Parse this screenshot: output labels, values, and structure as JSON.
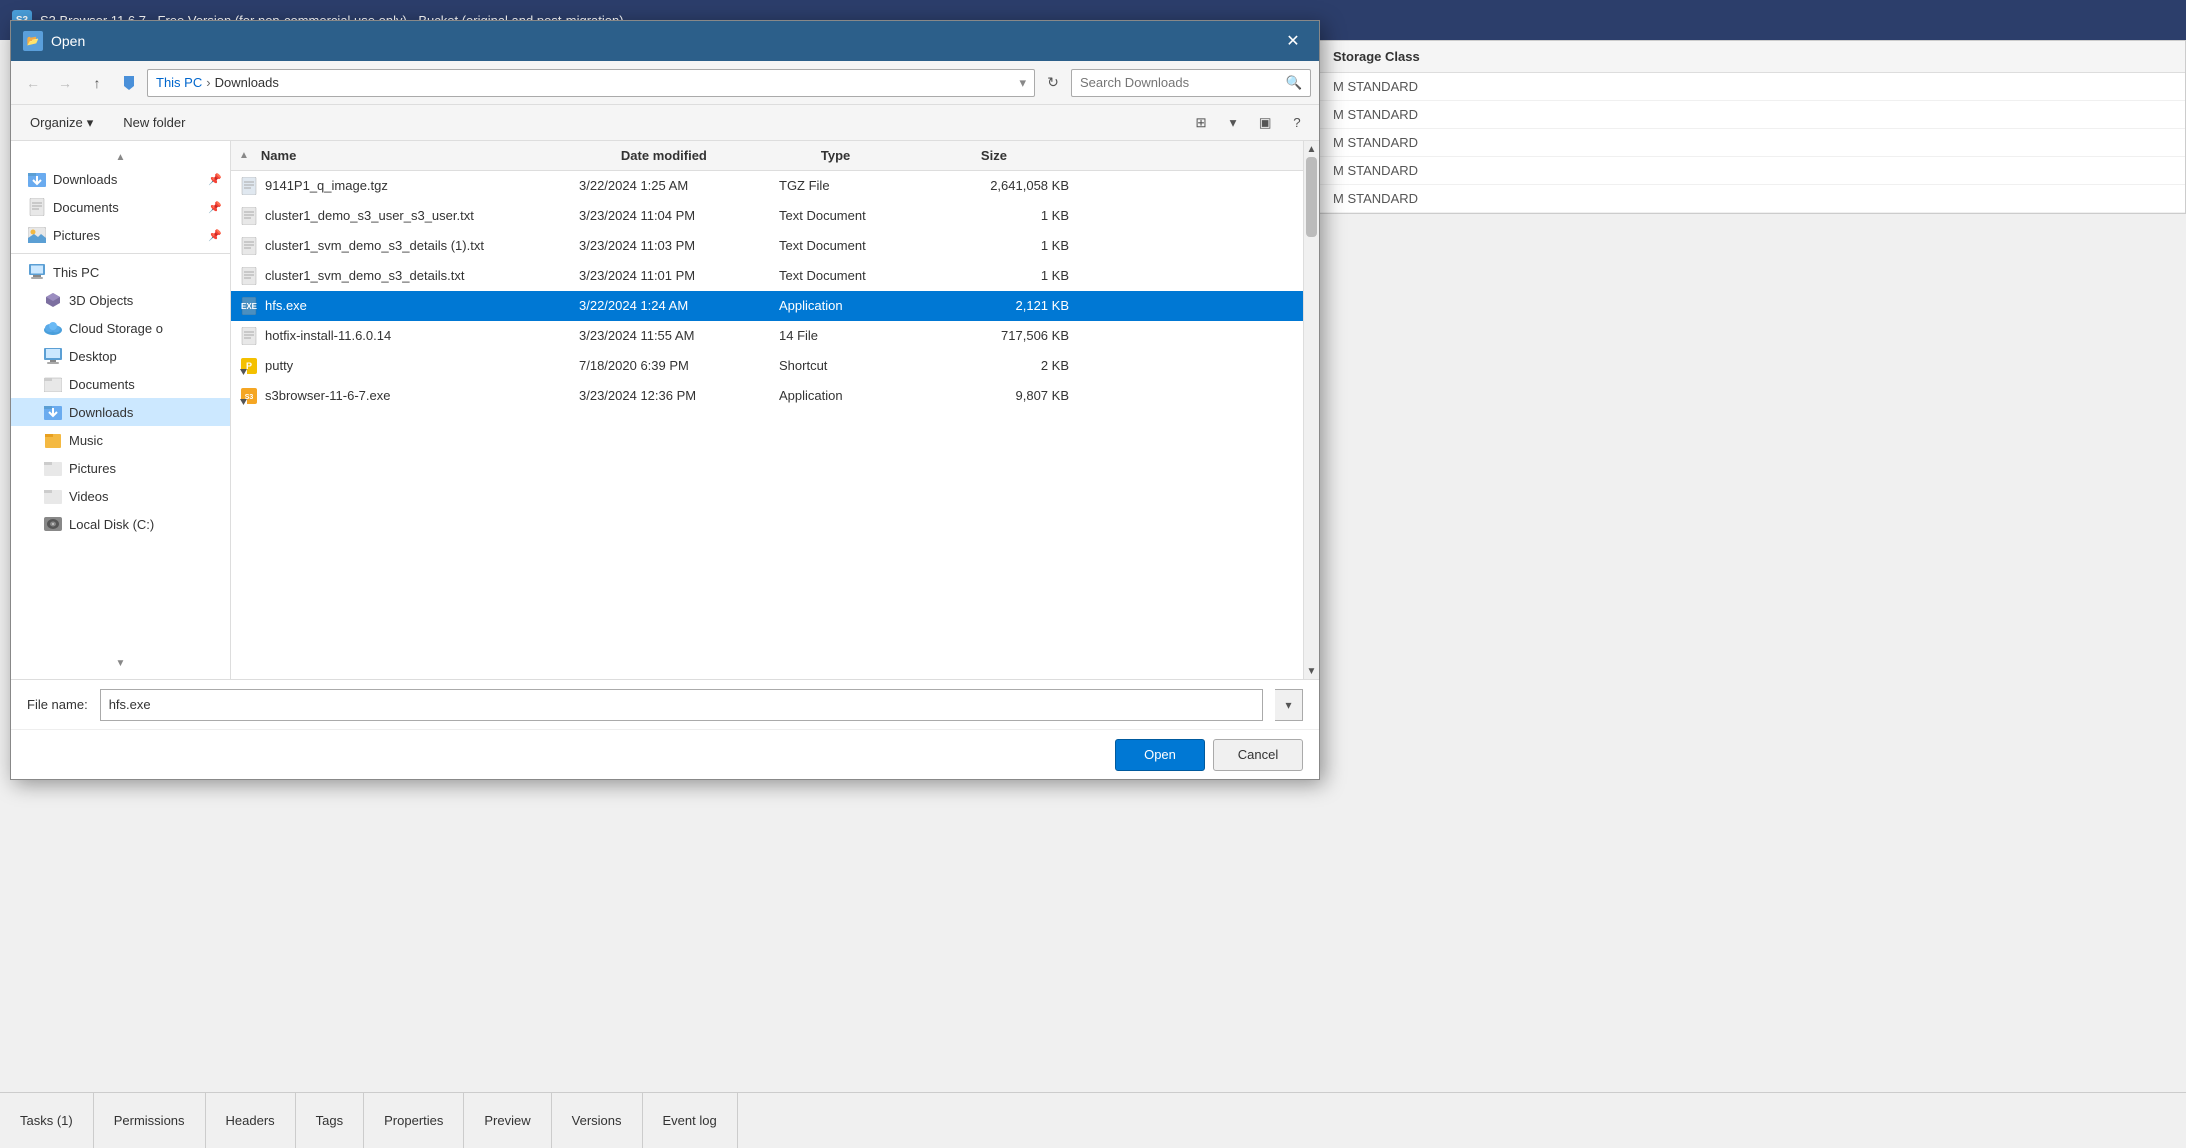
{
  "titlebar": {
    "title": "S3 Browser 11.6.7 - Free Version (for non-commercial use only) - Bucket (original and post-migration)"
  },
  "storage_class_panel": {
    "header": "Storage Class",
    "rows": [
      {
        "label": "M",
        "value": "STANDARD"
      },
      {
        "label": "M",
        "value": "STANDARD"
      },
      {
        "label": "M",
        "value": "STANDARD"
      },
      {
        "label": "M",
        "value": "STANDARD"
      },
      {
        "label": "M",
        "value": "STANDARD"
      }
    ]
  },
  "dialog": {
    "title": "Open",
    "close_btn": "✕"
  },
  "address": {
    "this_pc": "This PC",
    "separator": "›",
    "current_folder": "Downloads",
    "dropdown_arrow": "▾",
    "refresh_icon": "↻"
  },
  "search": {
    "placeholder": "Search Downloads",
    "icon": "🔍"
  },
  "toolbar": {
    "organize_label": "Organize",
    "organize_arrow": "▾",
    "new_folder_label": "New folder",
    "view_icon": "⊞",
    "help_icon": "?"
  },
  "columns": {
    "sort_arrow": "▲",
    "name": "Name",
    "date_modified": "Date modified",
    "type": "Type",
    "size": "Size"
  },
  "nav_items": {
    "quick_access_header": "",
    "downloads_quick": "Downloads",
    "documents_quick": "Documents",
    "pictures_quick": "Pictures",
    "this_pc": "This PC",
    "objects_3d": "3D Objects",
    "cloud_storage": "Cloud Storage o",
    "desktop": "Desktop",
    "documents": "Documents",
    "downloads": "Downloads",
    "music": "Music",
    "pictures": "Pictures",
    "videos": "Videos",
    "local_disk": "Local Disk (C:)"
  },
  "files": [
    {
      "name": "9141P1_q_image.tgz",
      "date": "3/22/2024 1:25 AM",
      "type": "TGZ File",
      "size": "2,641,058 KB",
      "icon_type": "file",
      "selected": false
    },
    {
      "name": "cluster1_demo_s3_user_s3_user.txt",
      "date": "3/23/2024 11:04 PM",
      "type": "Text Document",
      "size": "1 KB",
      "icon_type": "file",
      "selected": false
    },
    {
      "name": "cluster1_svm_demo_s3_details (1).txt",
      "date": "3/23/2024 11:03 PM",
      "type": "Text Document",
      "size": "1 KB",
      "icon_type": "file",
      "selected": false
    },
    {
      "name": "cluster1_svm_demo_s3_details.txt",
      "date": "3/23/2024 11:01 PM",
      "type": "Text Document",
      "size": "1 KB",
      "icon_type": "file",
      "selected": false
    },
    {
      "name": "hfs.exe",
      "date": "3/22/2024 1:24 AM",
      "type": "Application",
      "size": "2,121 KB",
      "icon_type": "exe",
      "selected": true
    },
    {
      "name": "hotfix-install-11.6.0.14",
      "date": "3/23/2024 11:55 AM",
      "type": "14 File",
      "size": "717,506 KB",
      "icon_type": "file",
      "selected": false
    },
    {
      "name": "putty",
      "date": "7/18/2020 6:39 PM",
      "type": "Shortcut",
      "size": "2 KB",
      "icon_type": "putty",
      "selected": false
    },
    {
      "name": "s3browser-11-6-7.exe",
      "date": "3/23/2024 12:36 PM",
      "type": "Application",
      "size": "9,807 KB",
      "icon_type": "s3",
      "selected": false
    }
  ],
  "filename_bar": {
    "label": "File name:",
    "value": "hfs.exe",
    "dropdown_arrow": "▾"
  },
  "buttons": {
    "open": "Open",
    "cancel": "Cancel"
  },
  "taskbar": {
    "tabs": [
      {
        "label": "Tasks (1)"
      },
      {
        "label": "Permissions"
      },
      {
        "label": "Headers"
      },
      {
        "label": "Tags"
      },
      {
        "label": "Properties"
      },
      {
        "label": "Preview"
      },
      {
        "label": "Versions"
      },
      {
        "label": "Event log"
      }
    ]
  }
}
